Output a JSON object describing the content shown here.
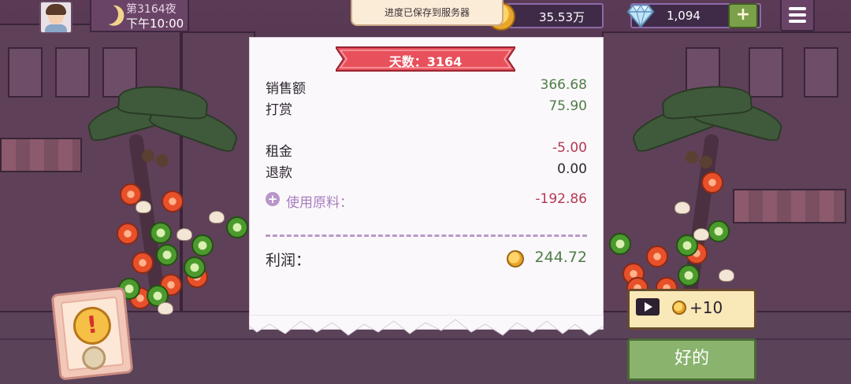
{
  "top_bar": {
    "day_label": "第3164夜",
    "time_label": "下午10:00",
    "toast": "进度已保存到服务器",
    "coins": "35.53万",
    "gems": "1,094",
    "plus_label": "+"
  },
  "receipt": {
    "ribbon_title": "天数：3164",
    "rows": [
      {
        "label": "销售额",
        "value": "366.68"
      },
      {
        "label": "打赏",
        "value": "75.90"
      },
      {
        "label": "租金",
        "value": "-5.00"
      },
      {
        "label": "退款",
        "value": "0.00"
      },
      {
        "label": "使用原料：",
        "value": "-192.86"
      }
    ],
    "profit_label": "利润：",
    "profit_value": "244.72"
  },
  "buttons": {
    "ad_reward": "+10",
    "ok": "好的"
  },
  "colors": {
    "positive": "#4f7d48",
    "negative": "#b23a52",
    "ribbon": "#e8505b",
    "ok_button": "#8ab36e",
    "ad_button": "#f9e8b8"
  }
}
